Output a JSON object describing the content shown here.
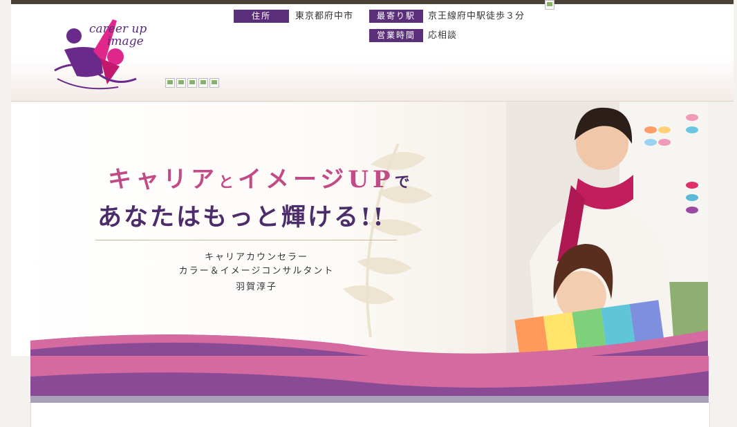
{
  "header": {
    "logo": {
      "line1": "career up",
      "line2": "image"
    },
    "info": {
      "address_label": "住所",
      "address_value": "東京都府中市",
      "station_label": "最寄り駅",
      "station_value": "京王線府中駅徒歩３分",
      "hours_label": "営業時間",
      "hours_value": "応相談"
    }
  },
  "hero": {
    "title_line1_part1": "キャリア",
    "title_line1_small": "と",
    "title_line1_part2": "イメージUP",
    "title_line1_end": "で",
    "title_line2": "あなたはもっと輝ける!!",
    "subtitle_line1": "キャリアカウンセラー",
    "subtitle_line2": "カラー＆イメージコンサルタント",
    "subtitle_line3": "羽賀淳子"
  },
  "colors": {
    "accent_purple": "#5c2f7a",
    "accent_pink": "#c24a86",
    "wave_purple": "#8a4a96",
    "wave_pink": "#d46aa0"
  }
}
